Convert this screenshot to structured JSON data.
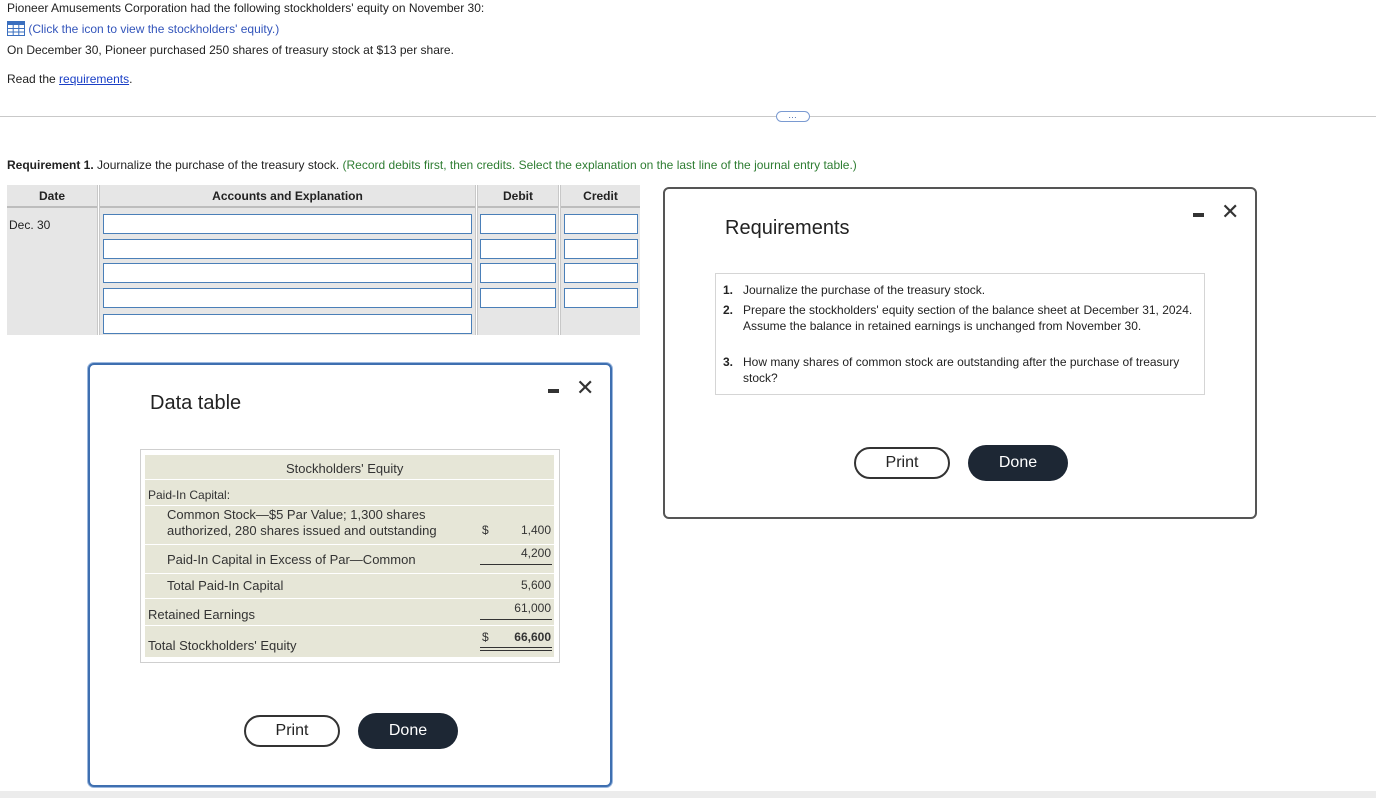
{
  "intro": {
    "line1": "Pioneer Amusements Corporation had the following stockholders' equity on November 30:",
    "icon_link": "(Click the icon to view the stockholders' equity.)",
    "line3": "On December 30, Pioneer purchased 250 shares of treasury stock at $13 per share.",
    "read_prefix": "Read the ",
    "read_link": "requirements",
    "read_suffix": "."
  },
  "more_button": "…",
  "requirement1": {
    "bold": "Requirement 1.",
    "text": " Journalize the purchase of the treasury stock.",
    "instruction": " (Record debits first, then credits. Select the explanation on the last line of the journal entry table.)"
  },
  "journal": {
    "headers": {
      "date": "Date",
      "accounts": "Accounts and Explanation",
      "debit": "Debit",
      "credit": "Credit"
    },
    "date_value": "Dec. 30",
    "rows": 5
  },
  "data_table_modal": {
    "title": "Data table",
    "minimize": "−",
    "close": "✕",
    "table": {
      "heading": "Stockholders' Equity",
      "section": "Paid-In Capital:",
      "common_stock_line1": "Common Stock—$5 Par Value; 1,300 shares",
      "common_stock_line2": "authorized, 280 shares issued and outstanding",
      "common_stock_currency": "$",
      "common_stock_value": "1,400",
      "apic_label": "Paid-In Capital in Excess of Par—Common",
      "apic_value": "4,200",
      "total_paid_in_label": "Total Paid-In Capital",
      "total_paid_in_value": "5,600",
      "retained_label": "Retained Earnings",
      "retained_value": "61,000",
      "total_equity_label": "Total Stockholders' Equity",
      "total_equity_currency": "$",
      "total_equity_value": "66,600"
    },
    "print_label": "Print",
    "done_label": "Done"
  },
  "requirements_modal": {
    "title": "Requirements",
    "items": [
      {
        "num": "1.",
        "text": "Journalize the purchase of the treasury stock."
      },
      {
        "num": "2.",
        "text": "Prepare the stockholders' equity section of the balance sheet at December 31, 2024. Assume the balance in retained earnings is unchanged from November 30."
      },
      {
        "num": "3.",
        "text": "How many shares of common stock are outstanding after the purchase of treasury stock?"
      }
    ],
    "print_label": "Print",
    "done_label": "Done"
  },
  "colors": {
    "link": "#1a3fc6",
    "instruction_green": "#2e7d32",
    "table_beige": "#e6e6d7",
    "done_button": "#1d2734"
  }
}
